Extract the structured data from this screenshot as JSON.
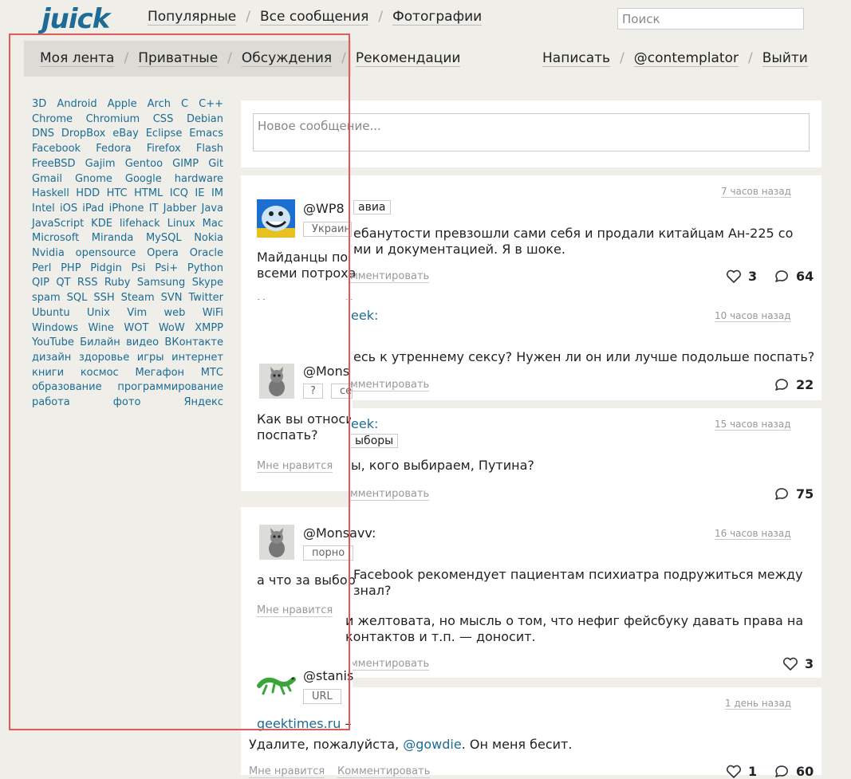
{
  "header": {
    "logo": "juick",
    "nav": [
      "Популярные",
      "Все сообщения",
      "Фотографии"
    ],
    "search_placeholder": "Поиск"
  },
  "subnav": {
    "left": [
      "Моя лента",
      "Приватные",
      "Обсуждения",
      "Рекомендации"
    ],
    "right": [
      "Написать",
      "@contemplator",
      "Выйти"
    ]
  },
  "tags": [
    "3D",
    "Android",
    "Apple",
    "Arch",
    "C",
    "C++",
    "Chrome",
    "Chromium",
    "CSS",
    "Debian",
    "DNS",
    "DropBox",
    "eBay",
    "Eclipse",
    "Emacs",
    "Facebook",
    "Fedora",
    "Firefox",
    "Flash",
    "FreeBSD",
    "Gajim",
    "Gentoo",
    "GIMP",
    "Git",
    "Gmail",
    "Gnome",
    "Google",
    "hardware",
    "Haskell",
    "HDD",
    "HTC",
    "HTML",
    "ICQ",
    "IE",
    "IM",
    "Intel",
    "iOS",
    "iPad",
    "iPhone",
    "IT",
    "Jabber",
    "Java",
    "JavaScript",
    "KDE",
    "lifehack",
    "Linux",
    "Mac",
    "Microsoft",
    "Miranda",
    "MySQL",
    "Nokia",
    "Nvidia",
    "opensource",
    "Opera",
    "Oracle",
    "Perl",
    "PHP",
    "Pidgin",
    "Psi",
    "Psi+",
    "Python",
    "QIP",
    "QT",
    "RSS",
    "Ruby",
    "Samsung",
    "Skype",
    "spam",
    "SQL",
    "SSH",
    "Steam",
    "SVN",
    "Twitter",
    "Ubuntu",
    "Unix",
    "Vim",
    "web",
    "WiFi",
    "Windows",
    "Wine",
    "WOT",
    "WoW",
    "XMPP",
    "YouTube",
    "Билайн",
    "видео",
    "ВКонтакте",
    "дизайн",
    "здоровье",
    "игры",
    "интернет",
    "книги",
    "космос",
    "Мегафон",
    "МТС",
    "образование",
    "программирование",
    "работа",
    "фото",
    "Яндекс"
  ],
  "newpost_placeholder": "Новое сообщение...",
  "actions": {
    "like": "Мне нравится",
    "comment": "Комментировать"
  },
  "posts": [
    {
      "user": "@WP8",
      "tags": [
        "Украин",
        "авиа"
      ],
      "text_left": "Майданцы по\nвсеми потроха",
      "text_right": "ебанутости превзошли сами себя и продали китайцам Ан-225 со\nми и документацией. Я в шоке.",
      "time": "7 часов назад",
      "comment_visible": "мментировать",
      "likes": "3",
      "comments": "64"
    },
    {
      "user": "@Mons",
      "user_right": "eek:",
      "tags": [
        "?",
        "се"
      ],
      "text_left": "Как вы относи\nпоспать?",
      "text_right": "есь к утреннему сексу? Нужен ли он или лучше подольше поспать?",
      "time": "10 часов назад",
      "comment_visible": "мментировать",
      "comments": "22"
    },
    {
      "user_right": "eek:",
      "tag_right": "ыборы",
      "text_right": "ы, кого выбираем, Путина?",
      "time": "15 часов назад",
      "comment_visible": "мментировать",
      "comments": "75"
    },
    {
      "user": "@Monsavv:",
      "tags": [
        "порно"
      ],
      "text_left": "а что за выбор",
      "text_right": "Facebook рекомендует пациентам психиатра подружиться между\nзнал?",
      "text_right2": "и желтовата, но мысль о том, что нефиг фейсбуку давать права на\nконтактов и т.п. — доносит.",
      "time": "16 часов назад",
      "comment_visible": "мментировать",
      "likes": "3"
    },
    {
      "user": "@stanis",
      "tags": [
        "URL"
      ],
      "link": "geektimes.ru",
      "link_suffix": " –",
      "text_pre": "Удалите, пожалуйста, ",
      "mention": "@gowdie",
      "text_post": ". Он меня бесит.",
      "time": "1 день назад",
      "likes": "1",
      "comments": "60"
    }
  ],
  "colors": {
    "link": "#1c6c95",
    "background": "#efeee8",
    "selection": "#e05a5a"
  }
}
